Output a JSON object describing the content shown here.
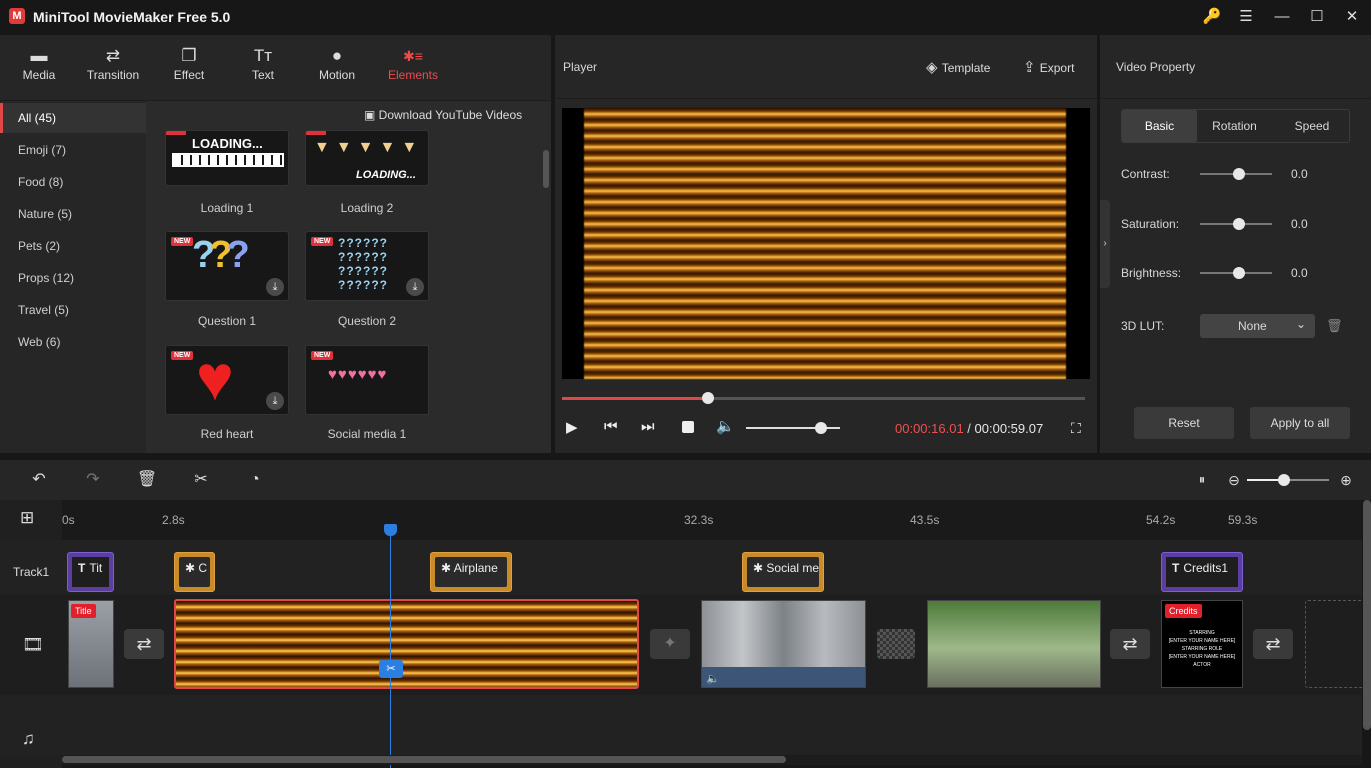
{
  "app": {
    "title": "MiniTool MovieMaker Free 5.0",
    "logo_letter": "M"
  },
  "window_buttons": {
    "key": "🔑",
    "menu": "☰",
    "minimize": "—",
    "maximize": "☐",
    "close": "✕"
  },
  "toolbar_tabs": [
    {
      "label": "Media",
      "icon": "▬"
    },
    {
      "label": "Transition",
      "icon": "⇄"
    },
    {
      "label": "Effect",
      "icon": "❐"
    },
    {
      "label": "Text",
      "icon": "Tт"
    },
    {
      "label": "Motion",
      "icon": "●"
    },
    {
      "label": "Elements",
      "icon": "✱≡"
    }
  ],
  "categories": [
    {
      "label": "All (45)"
    },
    {
      "label": "Emoji (7)"
    },
    {
      "label": "Food (8)"
    },
    {
      "label": "Nature (5)"
    },
    {
      "label": "Pets (2)"
    },
    {
      "label": "Props (12)"
    },
    {
      "label": "Travel (5)"
    },
    {
      "label": "Web (6)"
    }
  ],
  "download_link": "Download YouTube Videos",
  "elements": [
    {
      "label": "Loading 1",
      "new": "",
      "art": "LOADING..."
    },
    {
      "label": "Loading 2",
      "new": "",
      "art": "LOADING..."
    },
    {
      "label": "Question 1",
      "new": "NEW",
      "art": "???"
    },
    {
      "label": "Question 2",
      "new": "NEW",
      "art": "??????"
    },
    {
      "label": "Red heart",
      "new": "NEW",
      "art": "♥"
    },
    {
      "label": "Social media 1",
      "new": "NEW",
      "art": "♥♥♥♥♥♥"
    }
  ],
  "player": {
    "title": "Player",
    "template_label": "Template",
    "export_label": "Export",
    "time_current": "00:00:16.01",
    "time_separator": " / ",
    "time_total": "00:00:59.07",
    "progress": 0.28,
    "volume": 0.8
  },
  "property": {
    "title": "Video Property",
    "tabs": [
      "Basic",
      "Rotation",
      "Speed"
    ],
    "contrast_label": "Contrast:",
    "contrast_value": "0.0",
    "saturation_label": "Saturation:",
    "saturation_value": "0.0",
    "brightness_label": "Brightness:",
    "brightness_value": "0.0",
    "lut_label": "3D LUT:",
    "lut_value": "None",
    "reset_label": "Reset",
    "apply_label": "Apply to all"
  },
  "timeline": {
    "ruler": [
      "0s",
      "2.8s",
      "32.3s",
      "43.5s",
      "54.2s",
      "59.3s"
    ],
    "track_label": "Track1",
    "element_clips": [
      "Tit",
      "C",
      "Airplane",
      "Social me",
      "Credits1"
    ],
    "title_badge": "Title",
    "credits_badge": "Credits",
    "credits_text": [
      "STARRING",
      "[ENTER YOUR NAME HERE]",
      "STARRING ROLE",
      "[ENTER YOUR NAME HERE]",
      "ACTOR"
    ],
    "zoom": 0.45
  },
  "colors": {
    "accent": "#f04b4b",
    "element_clip": "#c98a2a",
    "text_clip": "#5a3fa0",
    "playhead": "#2a7fe0"
  }
}
